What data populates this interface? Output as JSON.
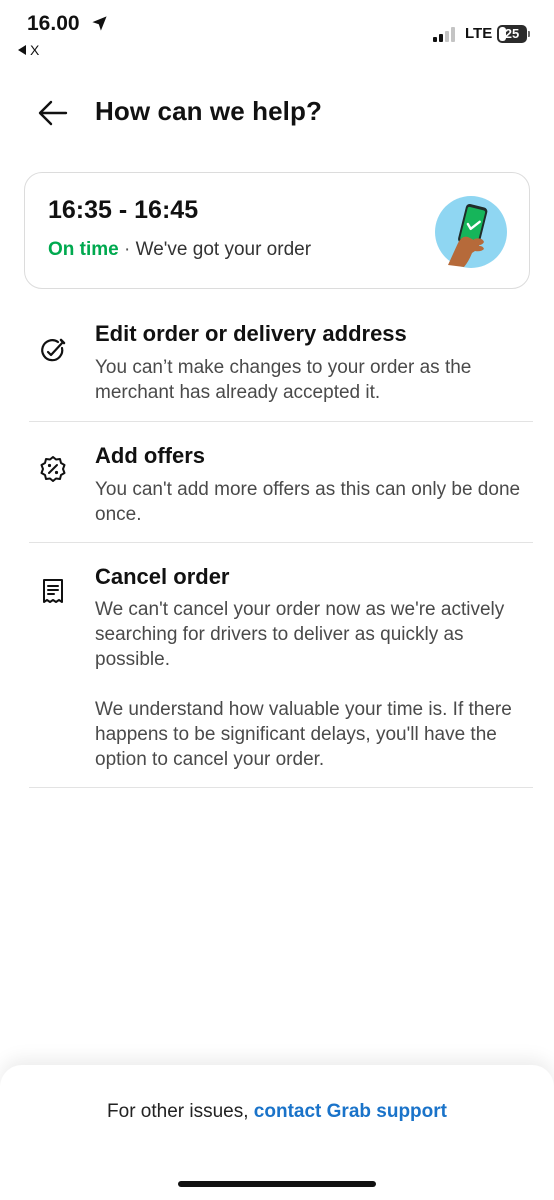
{
  "status_bar": {
    "time": "16.00",
    "back_app_label": "X",
    "network": "LTE",
    "battery_level": "25"
  },
  "header": {
    "title": "How can we help?"
  },
  "eta_card": {
    "time_window": "16:35 - 16:45",
    "status": "On time",
    "separator": "·",
    "message": "We've got your order",
    "status_color": "#00a94f"
  },
  "options": [
    {
      "icon": "pencil-check-icon",
      "title": "Edit order or delivery address",
      "description": "You can’t make changes to your order as the merchant has already accepted it."
    },
    {
      "icon": "discount-badge-icon",
      "title": "Add offers",
      "description": "You can't add more offers as this can only be done once."
    },
    {
      "icon": "receipt-icon",
      "title": "Cancel order",
      "description": "We can't cancel your order now as we're actively searching for drivers to deliver as quickly as possible.\n\nWe understand how valuable your time is. If there happens to be significant delays, you'll have the option to cancel your order."
    }
  ],
  "footer": {
    "prefix": "For other issues, ",
    "link_label": "contact Grab support",
    "link_color": "#1a73c9"
  }
}
